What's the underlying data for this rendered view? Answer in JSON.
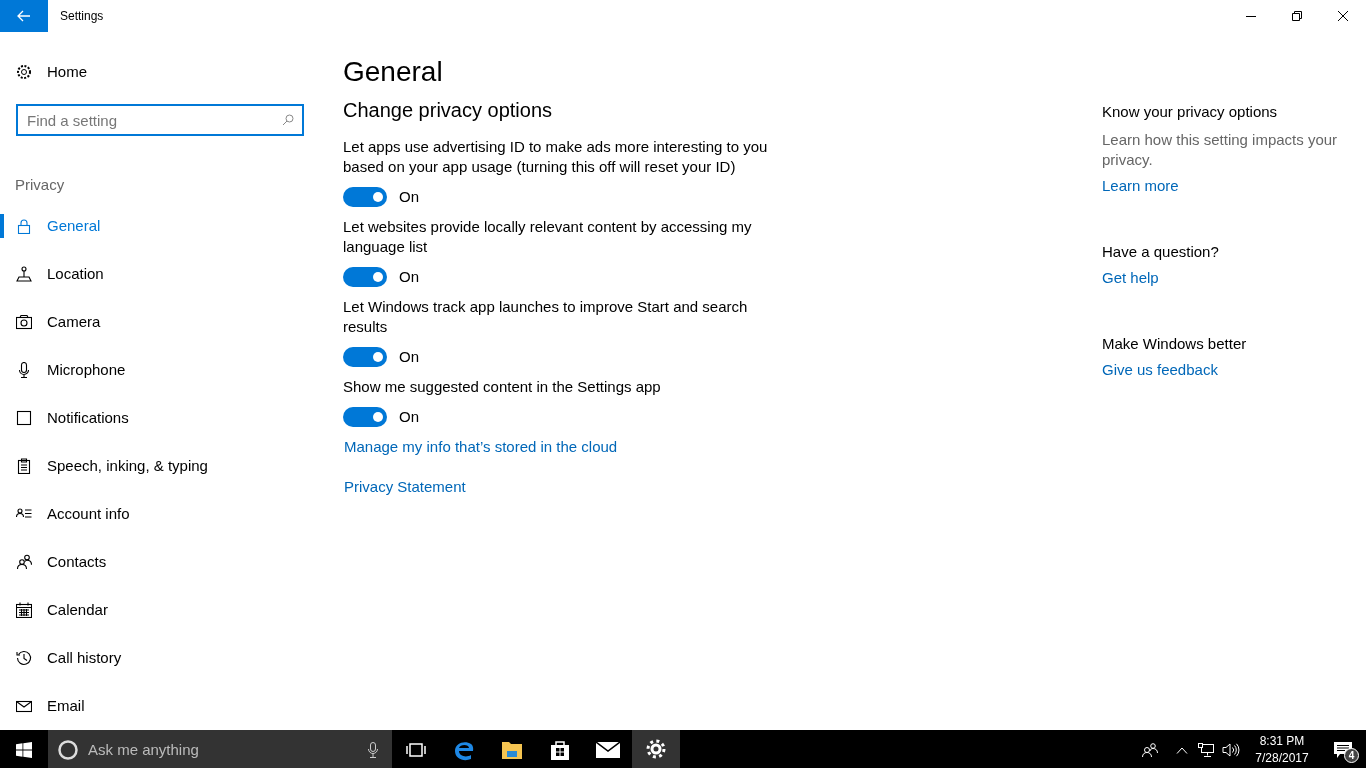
{
  "window": {
    "title": "Settings"
  },
  "sidebar": {
    "home": "Home",
    "search": {
      "placeholder": "Find a setting"
    },
    "section": "Privacy",
    "items": [
      {
        "label": "General",
        "selected": true
      },
      {
        "label": "Location",
        "selected": false
      },
      {
        "label": "Camera",
        "selected": false
      },
      {
        "label": "Microphone",
        "selected": false
      },
      {
        "label": "Notifications",
        "selected": false
      },
      {
        "label": "Speech, inking, & typing",
        "selected": false
      },
      {
        "label": "Account info",
        "selected": false
      },
      {
        "label": "Contacts",
        "selected": false
      },
      {
        "label": "Calendar",
        "selected": false
      },
      {
        "label": "Call history",
        "selected": false
      },
      {
        "label": "Email",
        "selected": false
      }
    ]
  },
  "main": {
    "title": "General",
    "subtitle": "Change privacy options",
    "options": [
      {
        "description": "Let apps use advertising ID to make ads more interesting to you based on your app usage (turning this off will reset your ID)",
        "on": true,
        "state_label": "On"
      },
      {
        "description": "Let websites provide locally relevant content by accessing my language list",
        "on": true,
        "state_label": "On"
      },
      {
        "description": "Let Windows track app launches to improve Start and search results",
        "on": true,
        "state_label": "On"
      },
      {
        "description": "Show me suggested content in the Settings app",
        "on": true,
        "state_label": "On"
      }
    ],
    "links": [
      "Manage my info that’s stored in the cloud",
      "Privacy Statement"
    ]
  },
  "aside": [
    {
      "heading": "Know your privacy options",
      "text": "Learn how this setting impacts your privacy.",
      "link": "Learn more"
    },
    {
      "heading": "Have a question?",
      "link": "Get help"
    },
    {
      "heading": "Make Windows better",
      "link": "Give us feedback"
    }
  ],
  "taskbar": {
    "search_placeholder": "Ask me anything",
    "time": "8:31 PM",
    "date": "7/28/2017",
    "notification_count": "4"
  }
}
